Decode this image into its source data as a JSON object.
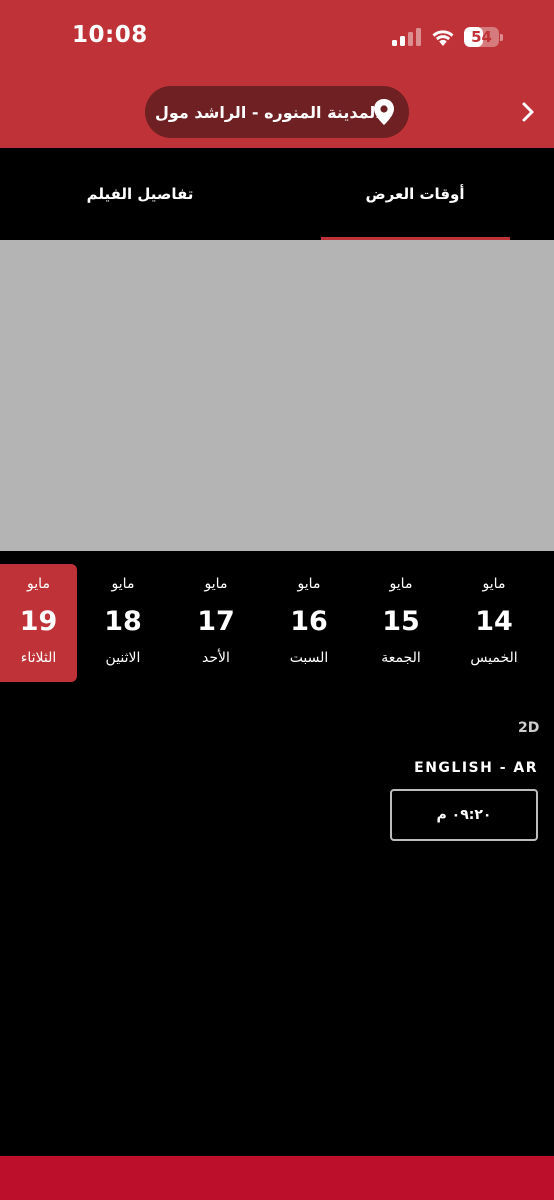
{
  "status_bar": {
    "time": "10:08",
    "battery_level": 54,
    "battery_label": "54",
    "signal_icon": "cellular-signal-icon",
    "wifi_icon": "wifi-icon"
  },
  "header": {
    "location": "المدينة المنوره - الراشد مول",
    "location_icon": "map-pin-icon",
    "nav_icon": "chevron-right-icon"
  },
  "tabs": [
    {
      "label": "أوقات العرض",
      "active": true
    },
    {
      "label": "تفاصيل الفيلم",
      "active": false
    }
  ],
  "dates": [
    {
      "month": "مايو",
      "day": "14",
      "weekday": "الخميس",
      "selected": false
    },
    {
      "month": "مايو",
      "day": "15",
      "weekday": "الجمعة",
      "selected": false
    },
    {
      "month": "مايو",
      "day": "16",
      "weekday": "السبت",
      "selected": false
    },
    {
      "month": "مايو",
      "day": "17",
      "weekday": "الأحد",
      "selected": false
    },
    {
      "month": "مايو",
      "day": "18",
      "weekday": "الاثنين",
      "selected": false
    },
    {
      "month": "مايو",
      "day": "19",
      "weekday": "الثلاثاء",
      "selected": true
    }
  ],
  "showtimes": {
    "format": "2D",
    "language": "ENGLISH - AR",
    "times": [
      "٠٩:٢٠ م"
    ]
  },
  "colors": {
    "brand_red": "#bf3338",
    "footer_red": "#bb0f2b",
    "pill": "#6e2022",
    "poster_placeholder": "#b4b4b4"
  }
}
